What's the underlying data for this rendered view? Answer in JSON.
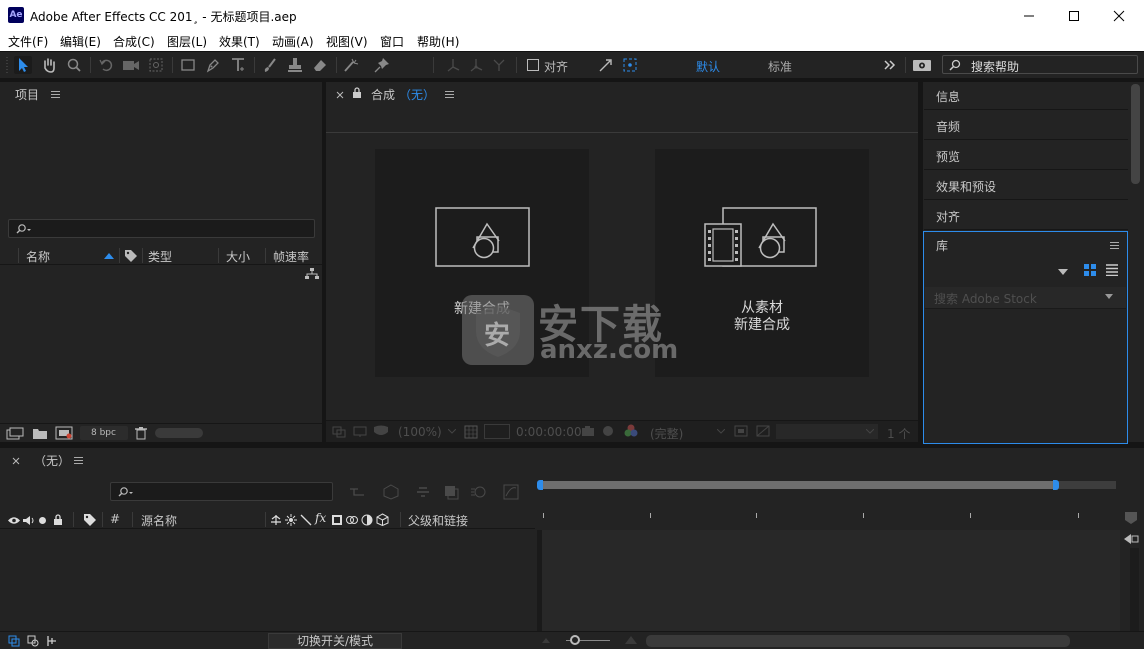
{
  "window": {
    "app_icon": "Ae",
    "title": "Adobe After Effects CC 201¸ - 无标题项目.aep",
    "controls": [
      "minimize-icon",
      "maximize-icon",
      "close-icon"
    ]
  },
  "menu": [
    "文件(F)",
    "编辑(E)",
    "合成(C)",
    "图层(L)",
    "效果(T)",
    "动画(A)",
    "视图(V)",
    "窗口",
    "帮助(H)"
  ],
  "toolbar": {
    "align_label": "对齐",
    "workspace_default": "默认",
    "workspace_standard": "标准",
    "search_help_placeholder": "搜索帮助",
    "accent_color": "#2d8ceb"
  },
  "project_panel": {
    "title": "项目",
    "columns": [
      "名称",
      "类型",
      "大小",
      "帧速率"
    ],
    "bpc": "8 bpc"
  },
  "composition_panel": {
    "title": "合成",
    "current": "（无）",
    "new_comp": "新建合成",
    "from_footage_line1": "从素材",
    "from_footage_line2": "新建合成",
    "zoom": "(100%)",
    "timecode": "0:00:00:00",
    "resolution": "(完整)",
    "views": "1 个"
  },
  "watermark": {
    "site_cn": "安下载",
    "site_domain": "anxz.com",
    "badge_char": "安"
  },
  "right_panels": {
    "items": [
      "信息",
      "音频",
      "预览",
      "效果和预设",
      "对齐"
    ],
    "library_title": "库",
    "library_search_placeholder": "搜索 Adobe Stock"
  },
  "timeline": {
    "title": "（无）",
    "columns": {
      "hash": "#",
      "source_name": "源名称",
      "parent_link": "父级和链接"
    },
    "toggle_label": "切换开关/模式"
  }
}
